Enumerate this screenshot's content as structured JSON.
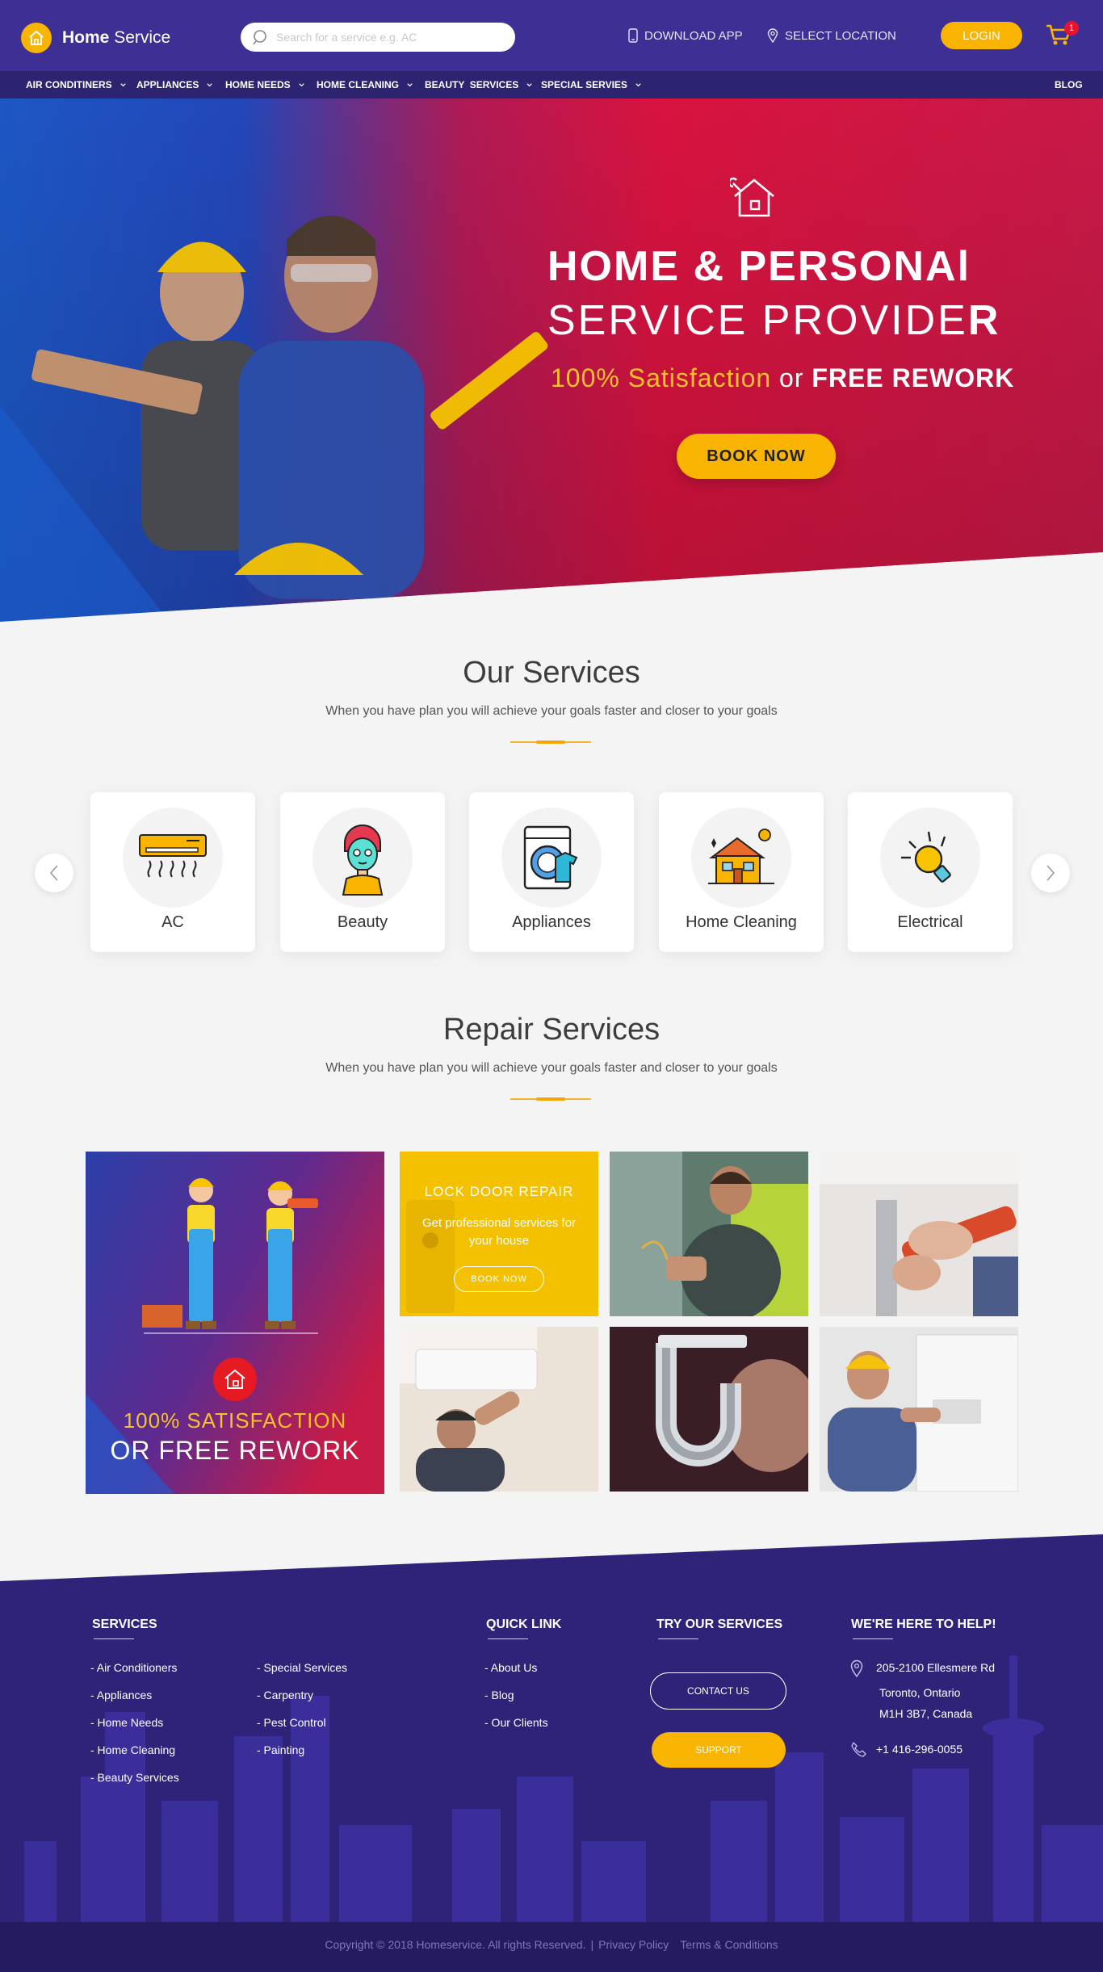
{
  "header": {
    "brand_bold": "Home",
    "brand_light": "Service",
    "search_placeholder": "Search for a service e.g. AC",
    "download_app": "DOWNLOAD APP",
    "select_location": "SELECT LOCATION",
    "login": "LOGIN",
    "cart_count": "1"
  },
  "nav": {
    "items": [
      "AIR CONDITINERS",
      "APPLIANCES",
      "HOME NEEDS",
      "HOME CLEANING",
      "BEAUTY  SERVICES",
      "SPECIAL SERVIES"
    ],
    "blog": "BLOG"
  },
  "hero": {
    "title_line1": "HOME & PERSONAl",
    "title_line2": "SERVICE PROVIDE",
    "title_line2_end": "R",
    "tag_highlight": "100% Satisfaction",
    "tag_or": "or",
    "tag_bold": "FREE REWORK",
    "book_now": "BOOK NOW"
  },
  "our_services": {
    "title": "Our Services",
    "subtitle": "When you have plan you will achieve your goals faster and closer to your goals",
    "cards": [
      {
        "label": "AC",
        "icon": "air-conditioner-icon"
      },
      {
        "label": "Beauty",
        "icon": "beauty-face-mask-icon"
      },
      {
        "label": "Appliances",
        "icon": "washing-machine-icon"
      },
      {
        "label": "Home Cleaning",
        "icon": "house-cleaning-icon"
      },
      {
        "label": "Electrical",
        "icon": "light-bulb-icon"
      }
    ]
  },
  "repair_services": {
    "title": "Repair Services",
    "subtitle": "When you have plan you will achieve your goals faster and closer to your goals",
    "promo_line1": "100% SATISFACTION",
    "promo_line2": "OR FREE REWORK",
    "lock_title": "LOCK DOOR REPAIR",
    "lock_text": "Get professional services for your house",
    "lock_button": "BOOK NOW"
  },
  "footer": {
    "services_heading": "SERVICES",
    "services_col1": [
      "- Air Conditioners",
      "- Appliances",
      "- Home Needs",
      "- Home Cleaning",
      "- Beauty Services"
    ],
    "services_col2": [
      "- Special Services",
      "- Carpentry",
      "- Pest Control",
      "- Painting"
    ],
    "quick_heading": "QUICK LINK",
    "quick_links": [
      "- About Us",
      "- Blog",
      "- Our Clients"
    ],
    "try_heading": "TRY OUR SERVICES",
    "contact_us": "CONTACT US",
    "support": "SUPPORT",
    "help_heading": "WE'RE HERE TO HELP!",
    "address_line1": "205-2100 Ellesmere Rd",
    "address_line2": "Toronto, Ontario",
    "address_line3": "M1H 3B7, Canada",
    "phone": "+1 416-296-0055",
    "copyright": "Copyright © 2018 Homeservice. All rights Reserved.",
    "copy_sep": "|",
    "privacy": "Privacy Policy",
    "terms": "Terms & Conditions"
  },
  "colors": {
    "header": "#3e2f94",
    "nav": "#2c2470",
    "accent": "#f8b400",
    "hero_red": "#d8133f",
    "hero_blue": "#1d57c4",
    "footer": "#2f2379"
  }
}
